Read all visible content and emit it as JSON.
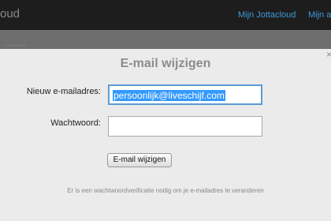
{
  "header": {
    "brand": "oud",
    "nav": [
      "Mijn Jottacloud",
      "Mijn ac"
    ]
  },
  "background": {
    "scribble": "········"
  },
  "dialog": {
    "title": "E-mail wijzigen",
    "close_glyph": "×",
    "email_label": "Nieuw e-mailadres:",
    "email_value": "persoonlijk@liveschijf.com",
    "password_label": "Wachtwoord:",
    "password_value": "",
    "submit_label": "E-mail wijzigen",
    "note": "Er is een wachtwoordverificatie nodig om je e-mailadres te veranderen"
  }
}
